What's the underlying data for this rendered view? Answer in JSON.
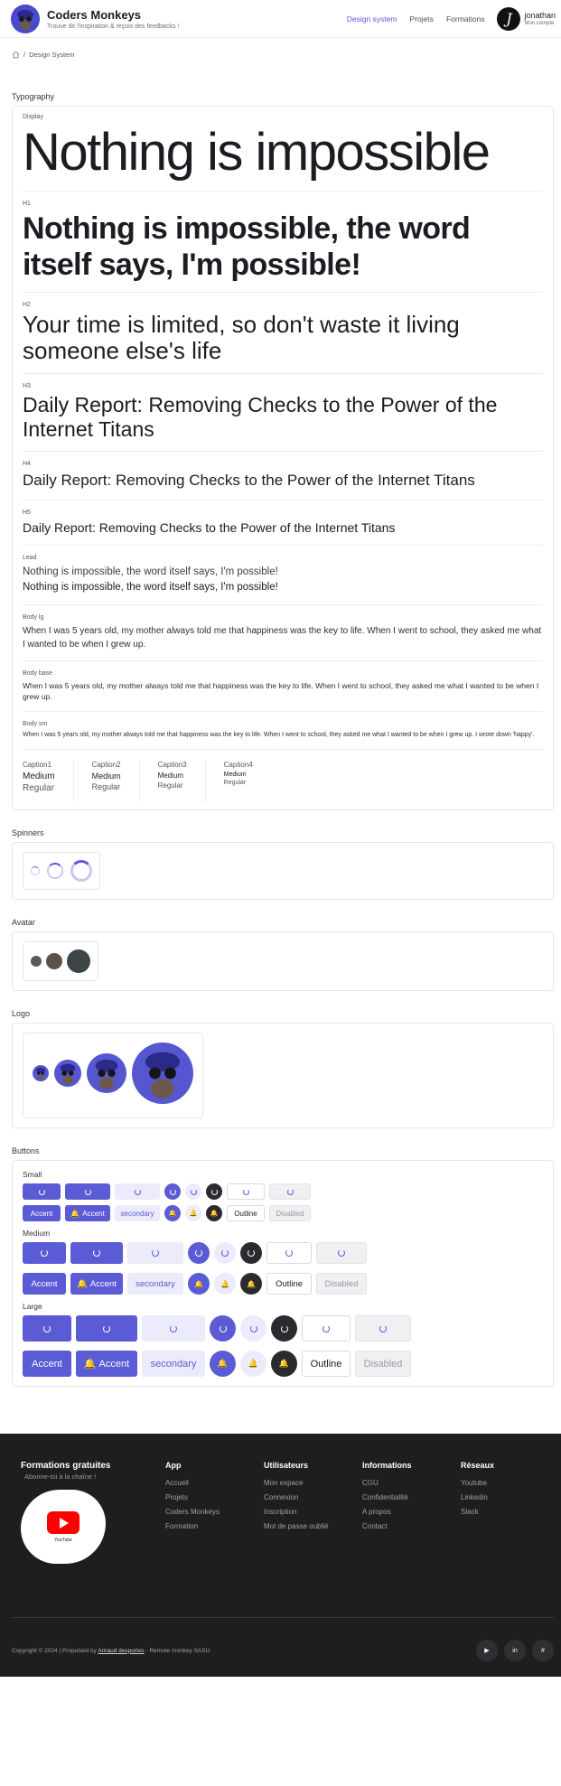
{
  "header": {
    "brand_name": "Coders Monkeys",
    "brand_tagline": "Trouve de l'inspiration & reçois des feedbacks !",
    "nav": [
      "Design system",
      "Projets",
      "Formations"
    ],
    "user_name": "jonathan",
    "user_sub": "Mon compte",
    "user_initial": "J"
  },
  "breadcrumb": {
    "current": "Design System",
    "separator": "/"
  },
  "typography": {
    "section_title": "Typography",
    "display_label": "Display",
    "display_text": "Nothing is impossible",
    "h1_label": "H1",
    "h1_text": "Nothing is impossible, the word itself says, I'm possible!",
    "h2_label": "H2",
    "h2_text": "Your time is limited, so don't waste it living someone else's life",
    "h3_label": "H3",
    "h3_text": "Daily Report: Removing Checks to the Power of the Internet Titans",
    "h4_label": "H4",
    "h4_text": "Daily Report: Removing Checks to the Power of the Internet Titans",
    "h5_label": "H5",
    "h5_text": "Daily Report: Removing Checks to the Power of the Internet Titans",
    "lead_label": "Lead",
    "lead_text_1": "Nothing is impossible, the word itself says, I'm possible!",
    "lead_text_2": "Nothing is impossible, the word itself says, I'm possible!",
    "body_lg_label": "Body lg",
    "body_lg_text": "When I was 5 years old, my mother always told me that happiness was the key to life. When I went to school, they asked me what I wanted to be when I grew up.",
    "body_base_label": "Body base",
    "body_base_text": "When I was 5 years old, my mother always told me that happiness was the key to life. When I went to school, they asked me what I wanted to be when I grew up.",
    "body_sm_label": "Body sm",
    "body_sm_text": "When I was 5 years old, my mother always told me that happiness was the key to life. When I went to school, they asked me what I wanted to be when I grew up. I wrote down 'happy'.",
    "captions": [
      {
        "name": "Caption1",
        "medium": "Medium",
        "regular": "Regular"
      },
      {
        "name": "Caption2",
        "medium": "Medium",
        "regular": "Regular"
      },
      {
        "name": "Caption3",
        "medium": "Medium",
        "regular": "Regular"
      },
      {
        "name": "Caption4",
        "medium": "Medium",
        "regular": "Regular"
      }
    ]
  },
  "spinners": {
    "section_title": "Spinners"
  },
  "avatar": {
    "section_title": "Avatar"
  },
  "logo": {
    "section_title": "Logo"
  },
  "buttons": {
    "section_title": "Buttons",
    "size_small": "Small",
    "size_medium": "Medium",
    "size_large": "Large",
    "accent_label": "Accent",
    "accent_icon_label": "Accent",
    "secondary_label": "secondary",
    "outline_label": "Outline",
    "disabled_label": "Disabled"
  },
  "footer": {
    "promo_title": "Formations gratuites",
    "promo_sub": "Abonne-toi à la chaîne !",
    "youtube_word": "YouTube",
    "columns": [
      {
        "title": "App",
        "links": [
          "Accueil",
          "Projets",
          "Coders Monkeys",
          "Formation"
        ]
      },
      {
        "title": "Utilisateurs",
        "links": [
          "Mon espace",
          "Connexion",
          "Inscription",
          "Mot de passe oublié"
        ]
      },
      {
        "title": "Informations",
        "links": [
          "CGU",
          "Confidentialité",
          "A propos",
          "Contact"
        ]
      },
      {
        "title": "Réseaux",
        "links": [
          "Youtube",
          "Linkedin",
          "Slack"
        ]
      }
    ],
    "copyright_prefix": "Copyright © 2024 | Propulsed by",
    "copyright_link": "Arnaud desportes",
    "copyright_suffix": "- Remote monkey SASU",
    "socials": [
      "youtube-icon",
      "linkedin-icon",
      "slack-icon"
    ]
  },
  "colors": {
    "accent": "#5b5bd6",
    "accent_soft": "#ecebfb",
    "dark": "#2b2b2f",
    "footer_bg": "#1e1e1e"
  }
}
